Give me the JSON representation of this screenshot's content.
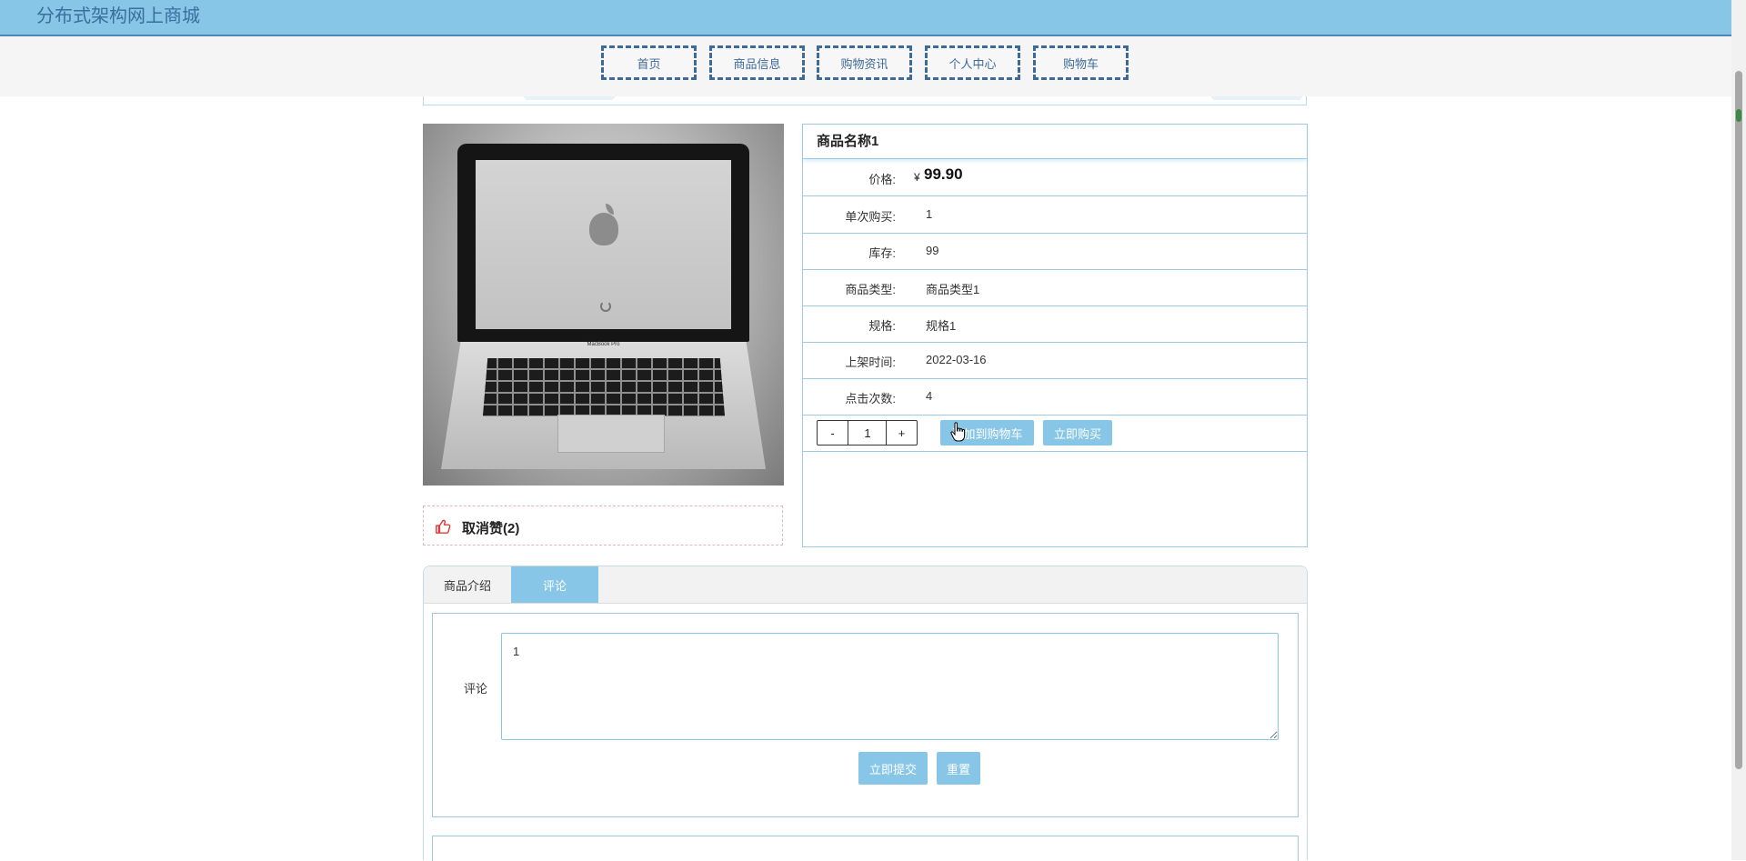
{
  "header": {
    "site_title": "分布式架构网上商城"
  },
  "nav": {
    "items": [
      "首页",
      "商品信息",
      "购物资讯",
      "个人中心",
      "购物车"
    ]
  },
  "product": {
    "name": "商品名称1",
    "price_label": "价格:",
    "currency": "¥",
    "price": "99.90",
    "rows": [
      {
        "label": "单次购买:",
        "value": "1"
      },
      {
        "label": "库存:",
        "value": "99"
      },
      {
        "label": "商品类型:",
        "value": "商品类型1"
      },
      {
        "label": "规格:",
        "value": "规格1"
      },
      {
        "label": "上架时间:",
        "value": "2022-03-16"
      },
      {
        "label": "点击次数:",
        "value": "4"
      }
    ],
    "image_caption": "MacBook Pro"
  },
  "purchase": {
    "minus": "-",
    "plus": "+",
    "quantity": "1",
    "add_to_cart": "添加到购物车",
    "buy_now": "立即购买"
  },
  "like": {
    "text": "取消赞(2)"
  },
  "tabs": {
    "intro": "商品介绍",
    "comments": "评论"
  },
  "comment_form": {
    "label": "评论",
    "value": "1",
    "submit": "立即提交",
    "reset": "重置"
  },
  "colors": {
    "accent": "#87c6e6",
    "nav_border": "#3e6a9a",
    "like_icon": "#e03a3a"
  },
  "icons": {
    "like": "thumbs-up-icon",
    "cursor": "hand-cursor-icon"
  }
}
